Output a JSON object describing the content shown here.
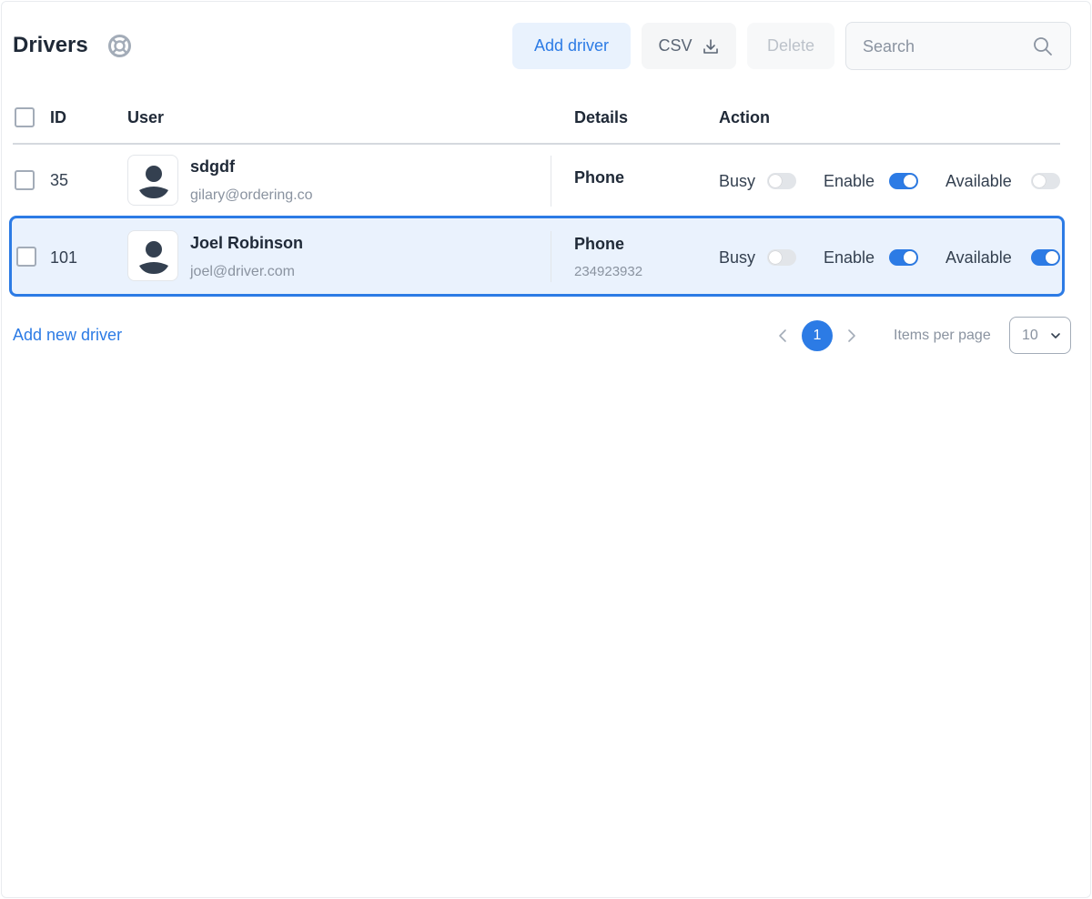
{
  "header": {
    "title": "Drivers",
    "add_driver_label": "Add driver",
    "csv_label": "CSV",
    "delete_label": "Delete",
    "search_placeholder": "Search"
  },
  "table": {
    "columns": {
      "id": "ID",
      "user": "User",
      "details": "Details",
      "action": "Action"
    },
    "rows": [
      {
        "id": "35",
        "name": "sdgdf",
        "email": "gilary@ordering.co",
        "details_label": "Phone",
        "details_value": "",
        "busy_label": "Busy",
        "busy": false,
        "enable_label": "Enable",
        "enable": true,
        "available_label": "Available",
        "available": false
      },
      {
        "id": "101",
        "name": "Joel Robinson",
        "email": "joel@driver.com",
        "details_label": "Phone",
        "details_value": "234923932",
        "busy_label": "Busy",
        "busy": false,
        "enable_label": "Enable",
        "enable": true,
        "available_label": "Available",
        "available": true
      }
    ]
  },
  "footer": {
    "add_new_label": "Add new driver",
    "current_page": "1",
    "items_per_page_label": "Items per page",
    "items_per_page": "10"
  },
  "colors": {
    "accent": "#2c7be5",
    "selected_row_bg": "#eaf2fd"
  },
  "icons": [
    "help-icon",
    "download-icon",
    "search-icon",
    "avatar-icon",
    "chevron-left-icon",
    "chevron-right-icon",
    "chevron-down-icon"
  ]
}
